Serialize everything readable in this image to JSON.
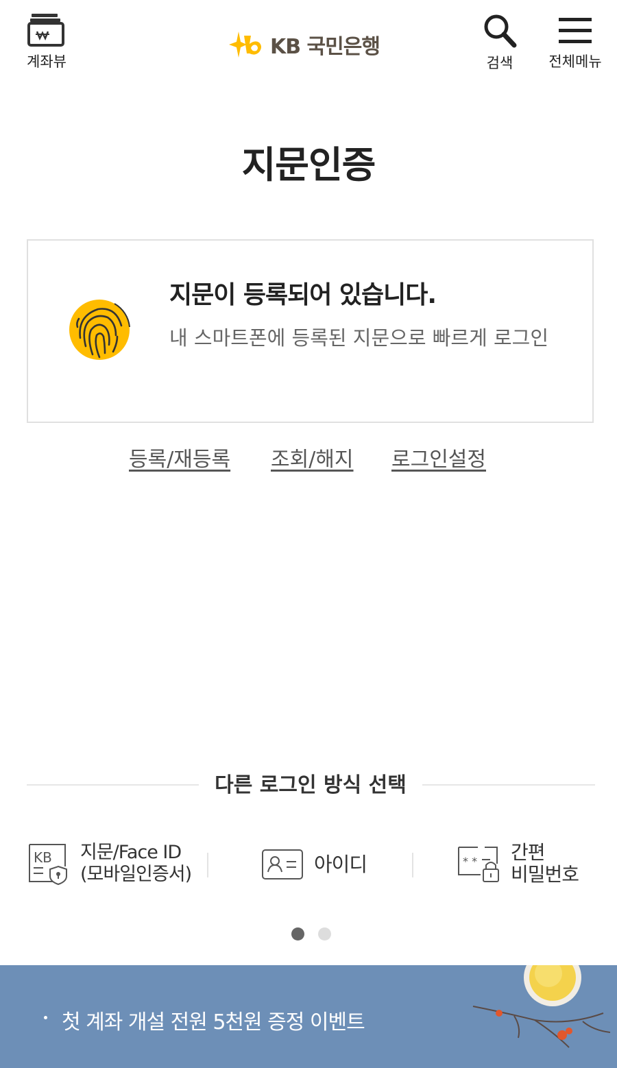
{
  "header": {
    "account_view_label": "계좌뷰",
    "logo_text": "KB 국민은행",
    "search_label": "검색",
    "menu_label": "전체메뉴"
  },
  "page": {
    "title": "지문인증"
  },
  "status_card": {
    "title": "지문이 등록되어 있습니다.",
    "description": "내 스마트폰에 등록된 지문으로 빠르게 로그인"
  },
  "actions": {
    "register": "등록/재등록",
    "inquiry": "조회/해지",
    "login_settings": "로그인설정"
  },
  "alt_login": {
    "title": "다른 로그인 방식 선택",
    "methods": [
      {
        "line1": "지문/Face ID",
        "line2": "(모바일인증서)",
        "icon": "kb-certificate-icon"
      },
      {
        "line1": "아이디",
        "icon": "id-card-icon"
      },
      {
        "line1": "간편",
        "line2": "비밀번호",
        "icon": "simple-password-icon"
      }
    ],
    "pager": {
      "current": 1,
      "total": 2
    }
  },
  "banner": {
    "text": "첫 계좌 개설 전원 5천원 증정 이벤트"
  },
  "colors": {
    "brand_yellow": "#FFBC00",
    "brand_brown": "#5B5146",
    "banner_blue": "#6D8FB7"
  }
}
